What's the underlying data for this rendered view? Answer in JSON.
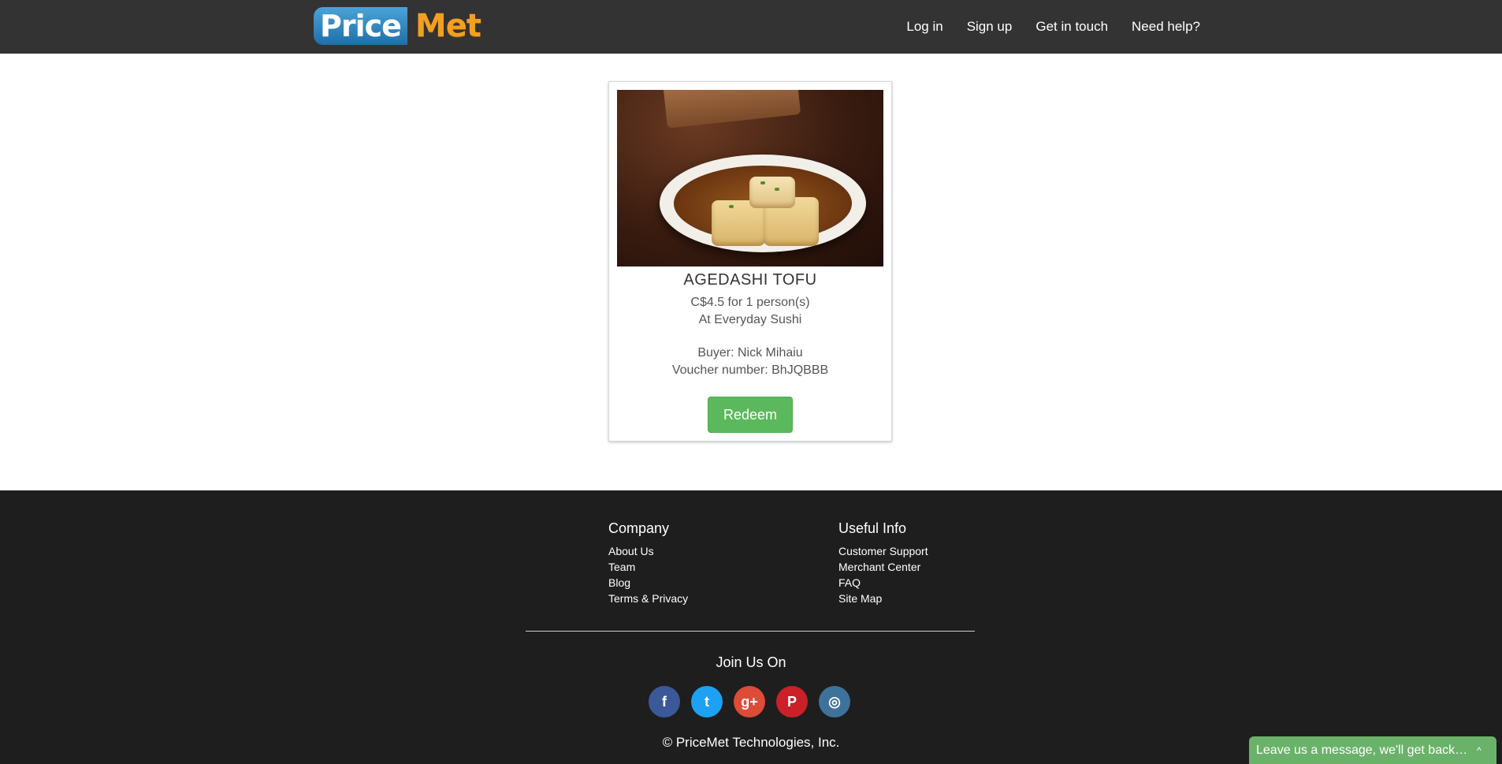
{
  "header": {
    "logo_price": "Price",
    "logo_met": "Met",
    "nav": [
      {
        "label": "Log in"
      },
      {
        "label": "Sign up"
      },
      {
        "label": "Get in touch"
      },
      {
        "label": "Need help?"
      }
    ]
  },
  "voucher": {
    "title": "AGEDASHI TOFU",
    "price_line": "C$4.5 for 1 person(s)",
    "venue_line": "At Everyday Sushi",
    "buyer_line": "Buyer: Nick Mihaiu",
    "voucher_line": "Voucher number: BhJQBBB",
    "redeem_label": "Redeem"
  },
  "footer": {
    "company": {
      "heading": "Company",
      "links": [
        "About Us",
        "Team",
        "Blog",
        "Terms & Privacy"
      ]
    },
    "useful": {
      "heading": "Useful Info",
      "links": [
        "Customer Support",
        "Merchant Center",
        "FAQ",
        "Site Map"
      ]
    },
    "join_heading": "Join Us On",
    "socials": [
      {
        "name": "facebook-icon",
        "glyph": "f",
        "color": "#3b5998"
      },
      {
        "name": "twitter-icon",
        "glyph": "t",
        "color": "#1da1f2"
      },
      {
        "name": "google-plus-icon",
        "glyph": "g+",
        "color": "#dd4b39"
      },
      {
        "name": "pinterest-icon",
        "glyph": "P",
        "color": "#cb2027"
      },
      {
        "name": "instagram-icon",
        "glyph": "◎",
        "color": "#3f729b"
      }
    ],
    "copyright": "© PriceMet Technologies, Inc."
  },
  "chat": {
    "label": "Leave us a message, we'll get back to you",
    "caret": "^"
  },
  "colors": {
    "header_bg": "#333333",
    "footer_bg": "#1e1e1e",
    "redeem_green": "#5cb85c",
    "chat_green": "#6ab26a",
    "logo_orange": "#f3a020",
    "logo_blue": "#1f6fa8"
  }
}
